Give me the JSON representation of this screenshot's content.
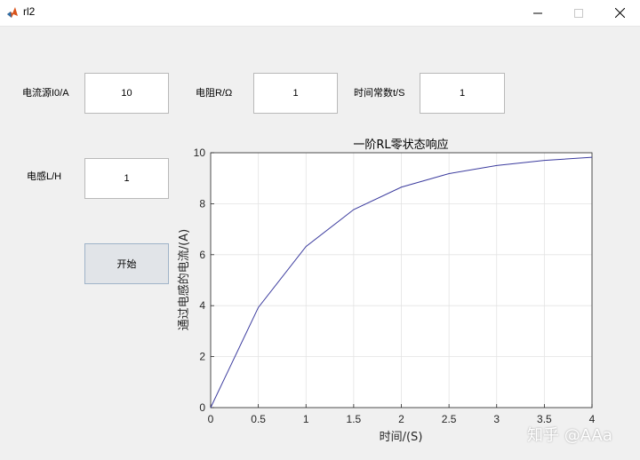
{
  "window": {
    "title": "rl2"
  },
  "form": {
    "source_label": "电流源I0/A",
    "source_value": "10",
    "resistance_label": "电阻R/Ω",
    "resistance_value": "1",
    "time_const_label": "时间常数t/S",
    "time_const_value": "1",
    "inductance_label": "电感L/H",
    "inductance_value": "1",
    "start_label": "开始"
  },
  "chart_data": {
    "type": "line",
    "title": "一阶RL零状态响应",
    "xlabel": "时间/(S)",
    "ylabel": "通过电感的电流/(A)",
    "xlim": [
      0,
      4
    ],
    "ylim": [
      0,
      10
    ],
    "xticks": [
      "0",
      "0.5",
      "1",
      "1.5",
      "2",
      "2.5",
      "3",
      "3.5",
      "4"
    ],
    "yticks": [
      "0",
      "2",
      "4",
      "6",
      "8",
      "10"
    ],
    "grid": true,
    "x": [
      0,
      0.5,
      1,
      1.5,
      2,
      2.5,
      3,
      3.5,
      4
    ],
    "values": [
      0,
      3.93,
      6.32,
      7.77,
      8.65,
      9.18,
      9.5,
      9.7,
      9.82
    ],
    "line_color": "#3b3b9e"
  },
  "watermark": "知乎 @AAa"
}
